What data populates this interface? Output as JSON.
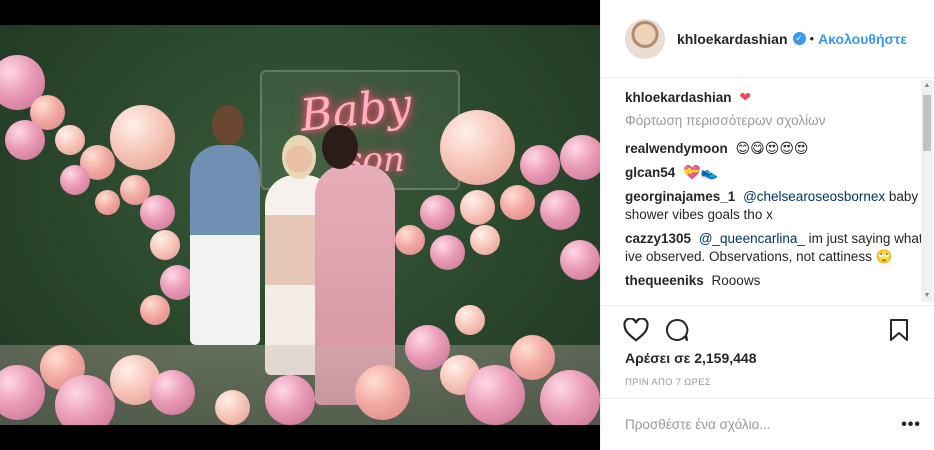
{
  "post": {
    "image_alt": "Party photo with pink balloons and neon sign",
    "neon_text_line1": "Baby",
    "neon_text_line2": "son",
    "carousel": {
      "count": 5,
      "active": 0
    }
  },
  "header": {
    "username": "khloekardashian",
    "verified_icon": "verified-badge-icon",
    "follow_label": "Ακολουθήστε"
  },
  "comments": {
    "caption": {
      "user": "khloekardashian",
      "text": "❤"
    },
    "load_more": "Φόρτωση περισσότερων σχολίων",
    "items": [
      {
        "user": "realwendymoon",
        "mention": "",
        "text": "😊😋😍😍😍"
      },
      {
        "user": "glcan54",
        "mention": "",
        "text": "💝👟"
      },
      {
        "user": "georginajames_1",
        "mention": "@chelsearoseosbornex",
        "text": "baby shower vibes goals tho x"
      },
      {
        "user": "cazzy1305",
        "mention": "@_queencarlina_",
        "text": "im just saying what ive observed. Observations, not cattiness 🙄"
      },
      {
        "user": "thequeeniks",
        "mention": "",
        "text": "Rooows"
      }
    ]
  },
  "actions": {
    "like_icon": "heart-icon",
    "comment_icon": "comment-icon",
    "save_icon": "bookmark-icon"
  },
  "likes_text": "Αρέσει σε 2,159,448",
  "timestamp": "ΠΡΙΝ ΑΠΟ 7 ΩΡΕΣ",
  "add_comment": {
    "placeholder": "Προσθέστε ένα σχόλιο...",
    "more_label": "•••"
  },
  "colors": {
    "accent": "#3897f0",
    "text": "#262626",
    "muted": "#999999"
  }
}
